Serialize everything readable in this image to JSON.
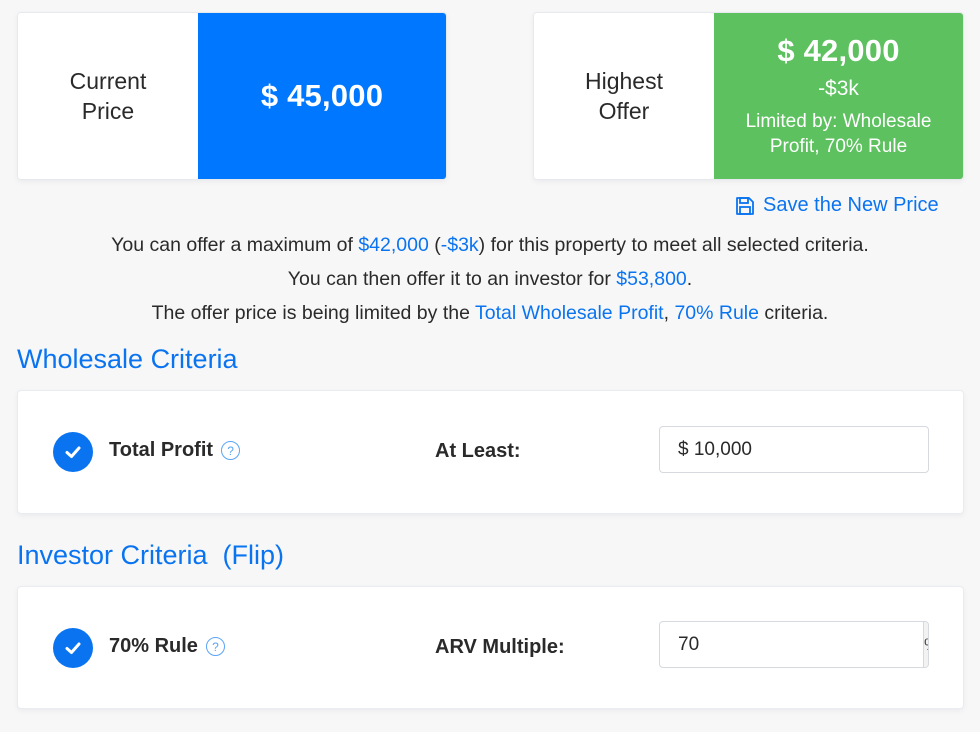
{
  "current_price": {
    "label_line1": "Current",
    "label_line2": "Price",
    "value": "$ 45,000"
  },
  "highest_offer": {
    "label_line1": "Highest",
    "label_line2": "Offer",
    "value": "$ 42,000",
    "delta": "-$3k",
    "limited_by": "Limited by: Wholesale Profit, 70% Rule"
  },
  "save_link": {
    "label": "Save the New Price",
    "icon": "floppy-disk-icon"
  },
  "summary": {
    "line1_pre": "You can offer a maximum of ",
    "line1_amount": "$42,000",
    "line1_mid": " (",
    "line1_delta": "-$3k",
    "line1_post": ") for this property to meet all selected criteria.",
    "line2_pre": "You can then offer it to an investor for ",
    "line2_amount": "$53,800",
    "line2_post": ".",
    "line3_pre": "The offer price is being limited by the ",
    "line3_link1": "Total Wholesale Profit",
    "line3_sep": ", ",
    "line3_link2": "70% Rule",
    "line3_post": " criteria."
  },
  "wholesale": {
    "title": "Wholesale Criteria",
    "criterion": {
      "name": "Total Profit",
      "checked": true,
      "help_icon": "?",
      "field_label": "At Least:",
      "value": "$ 10,000"
    }
  },
  "investor": {
    "title": "Investor Criteria  (Flip)",
    "criterion": {
      "name": "70% Rule",
      "checked": true,
      "help_icon": "?",
      "field_label": "ARV Multiple:",
      "value": "70",
      "addon": "%"
    }
  },
  "colors": {
    "primary_blue": "#0077ff",
    "success_green": "#5cc15e",
    "link_blue": "#0a74f0"
  }
}
